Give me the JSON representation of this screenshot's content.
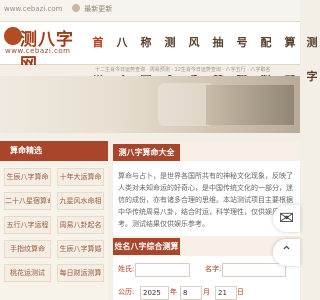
{
  "topbar": {
    "url": "www.cebazi.com",
    "bookmark": "最新更新"
  },
  "header": {
    "logo_title": "测八字网",
    "logo_domain": "www.cebazi.com",
    "nav": [
      "首页",
      "八字",
      "称骨",
      "测名",
      "风水",
      "抽签",
      "号码",
      "配对",
      "算卦",
      "测字"
    ],
    "active_nav": "首页"
  },
  "breadcrumb": "十二生肖今日运势查询 · 周易预测 · 12生肖今日运势查询 · 八字五行 · 八字取名",
  "left_panel": {
    "title": "算命精选",
    "links": [
      "生辰八字算命",
      "十年大运算命",
      "二十八星宿算命",
      "九星风水命相",
      "五行八字运程",
      "周易八卦起名",
      "手指纹算命",
      "生辰八字算婚",
      "桃花运测试",
      "每日财运测算"
    ]
  },
  "main_panel": {
    "section1_title": "测八字算命大全",
    "intro": "算命与占卜，是世界各国所共有的神秘文化现象，反映了人类对未知命运的好奇心，是中国传统文化的一部分，迷信的成份，亦有诸多合理的思维。本站测试项目主要根据中华传统周易八卦，结合时运，科学理性，仅供娱乐参考。测试结果仅供娱乐参考。",
    "section2_title": "姓名八字综合测算",
    "form": {
      "surname_label": "姓氏:",
      "name_label": "名字:",
      "birth_label": "公历:",
      "year": "2025",
      "year_suffix": "年",
      "month": "8",
      "month_suffix": "月",
      "day": "21",
      "day_suffix": "日"
    }
  },
  "side_buttons": {
    "wechat_icon": "wechat-icon",
    "top_icon": "up-icon"
  },
  "colors": {
    "brand": "#a8452a",
    "background": "#f4efe6"
  }
}
